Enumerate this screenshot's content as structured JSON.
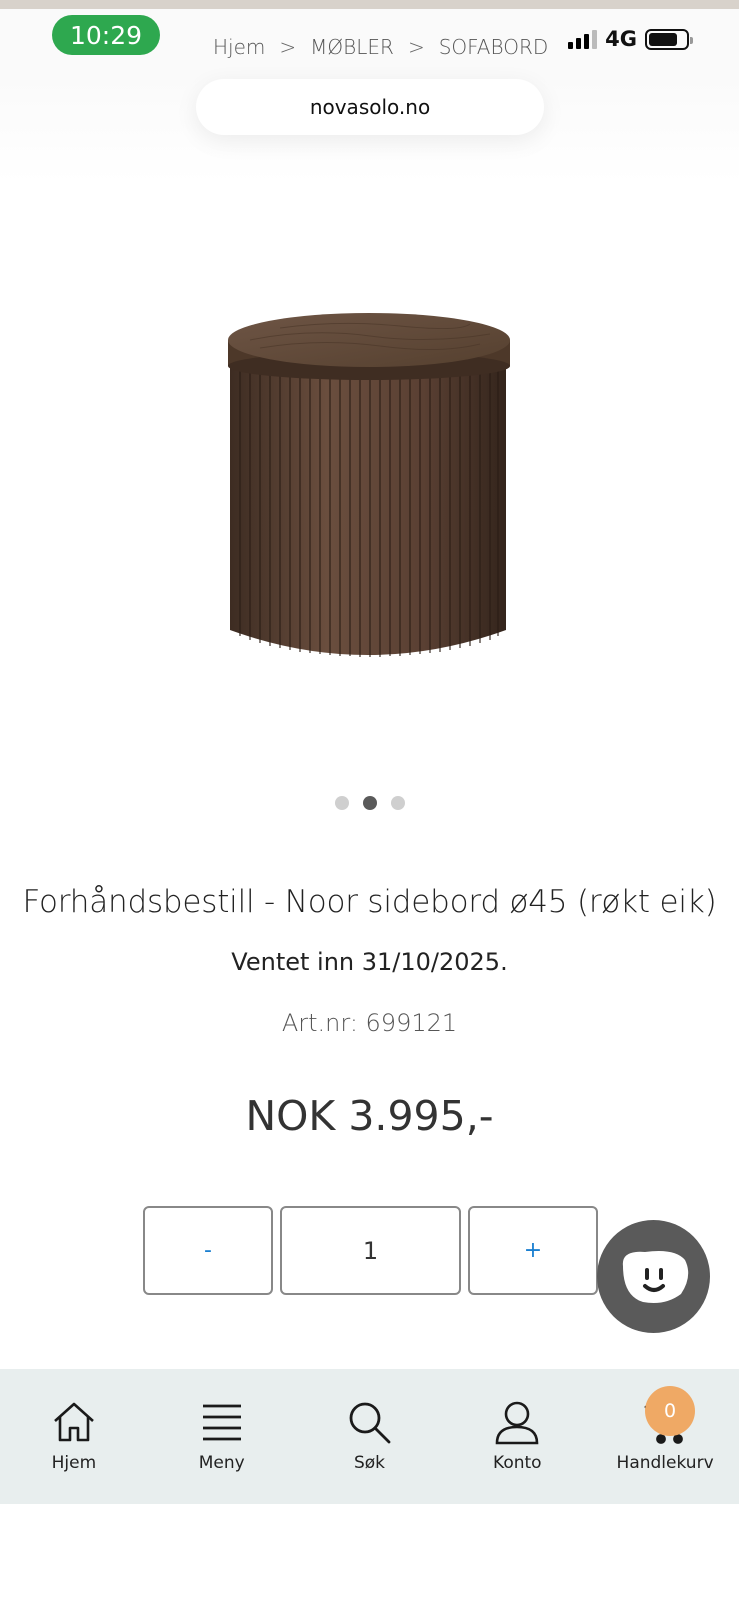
{
  "status_bar": {
    "time": "10:29",
    "network": "4G"
  },
  "breadcrumb": {
    "items": [
      "Hjem",
      "MØBLER",
      "SOFABORD"
    ],
    "separator": ">"
  },
  "browser": {
    "url": "novasolo.no"
  },
  "carousel": {
    "dot_count": 3,
    "active_index": 1
  },
  "product": {
    "title": "Forhåndsbestill - Noor sidebord ø45 (røkt eik)",
    "expected": "Ventet inn 31/10/2025.",
    "art_nr": "Art.nr: 699121",
    "price": "NOK 3.995,-"
  },
  "quantity": {
    "minus_label": "-",
    "value": "1",
    "plus_label": "+"
  },
  "colors": {
    "time_pill": "#2ea84f",
    "qty_accent": "#1a7fd0",
    "chat_bubble": "#5a5a5a",
    "nav_bg": "#e8eeee",
    "cart_badge": "#efa965",
    "wood": "#5b4335"
  },
  "bottom_nav": {
    "items": [
      {
        "label": "Hjem",
        "icon": "home-icon"
      },
      {
        "label": "Meny",
        "icon": "menu-icon"
      },
      {
        "label": "Søk",
        "icon": "search-icon"
      },
      {
        "label": "Konto",
        "icon": "user-icon"
      },
      {
        "label": "Handlekurv",
        "icon": "cart-icon"
      }
    ],
    "cart_count": "0"
  }
}
